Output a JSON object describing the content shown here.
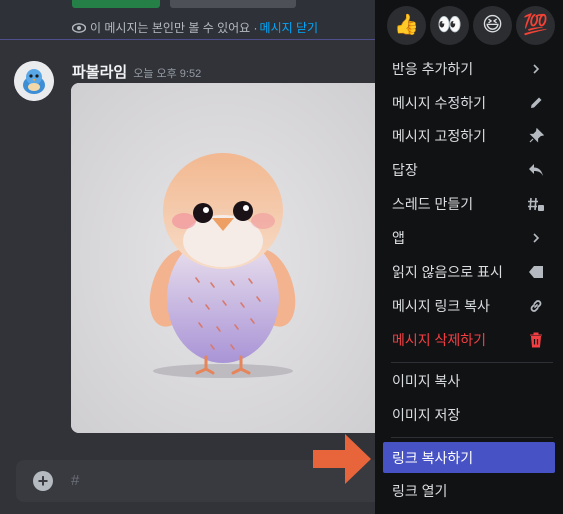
{
  "ephemeral": {
    "text": "이 메시지는 본인만 볼 수 있어요 · ",
    "dismiss": "메시지 닫기"
  },
  "message": {
    "author": "파볼라임",
    "timestamp": "오늘 오후 9:52"
  },
  "composer": {
    "placeholder": "#"
  },
  "reactions": [
    {
      "emoji": "👍",
      "icon": "thumbs-up"
    },
    {
      "emoji": "👀",
      "icon": "eyes"
    },
    {
      "emoji": "😆",
      "icon": "laughing"
    },
    {
      "emoji": "💯",
      "icon": "hundred-points"
    }
  ],
  "menu": {
    "add_reaction": "반응 추가하기",
    "edit_message": "메시지 수정하기",
    "pin_message": "메시지 고정하기",
    "reply": "답장",
    "create_thread": "스레드 만들기",
    "apps": "앱",
    "mark_unread": "읽지 않음으로 표시",
    "copy_message_link": "메시지 링크 복사",
    "delete_message": "메시지 삭제하기",
    "copy_image": "이미지 복사",
    "save_image": "이미지 저장",
    "copy_link": "링크 복사하기",
    "open_link": "링크 열기"
  },
  "colors": {
    "accent": "#4752c4",
    "danger": "#f23f43",
    "link": "#00a8fc",
    "annotation_arrow": "#e8643a"
  }
}
